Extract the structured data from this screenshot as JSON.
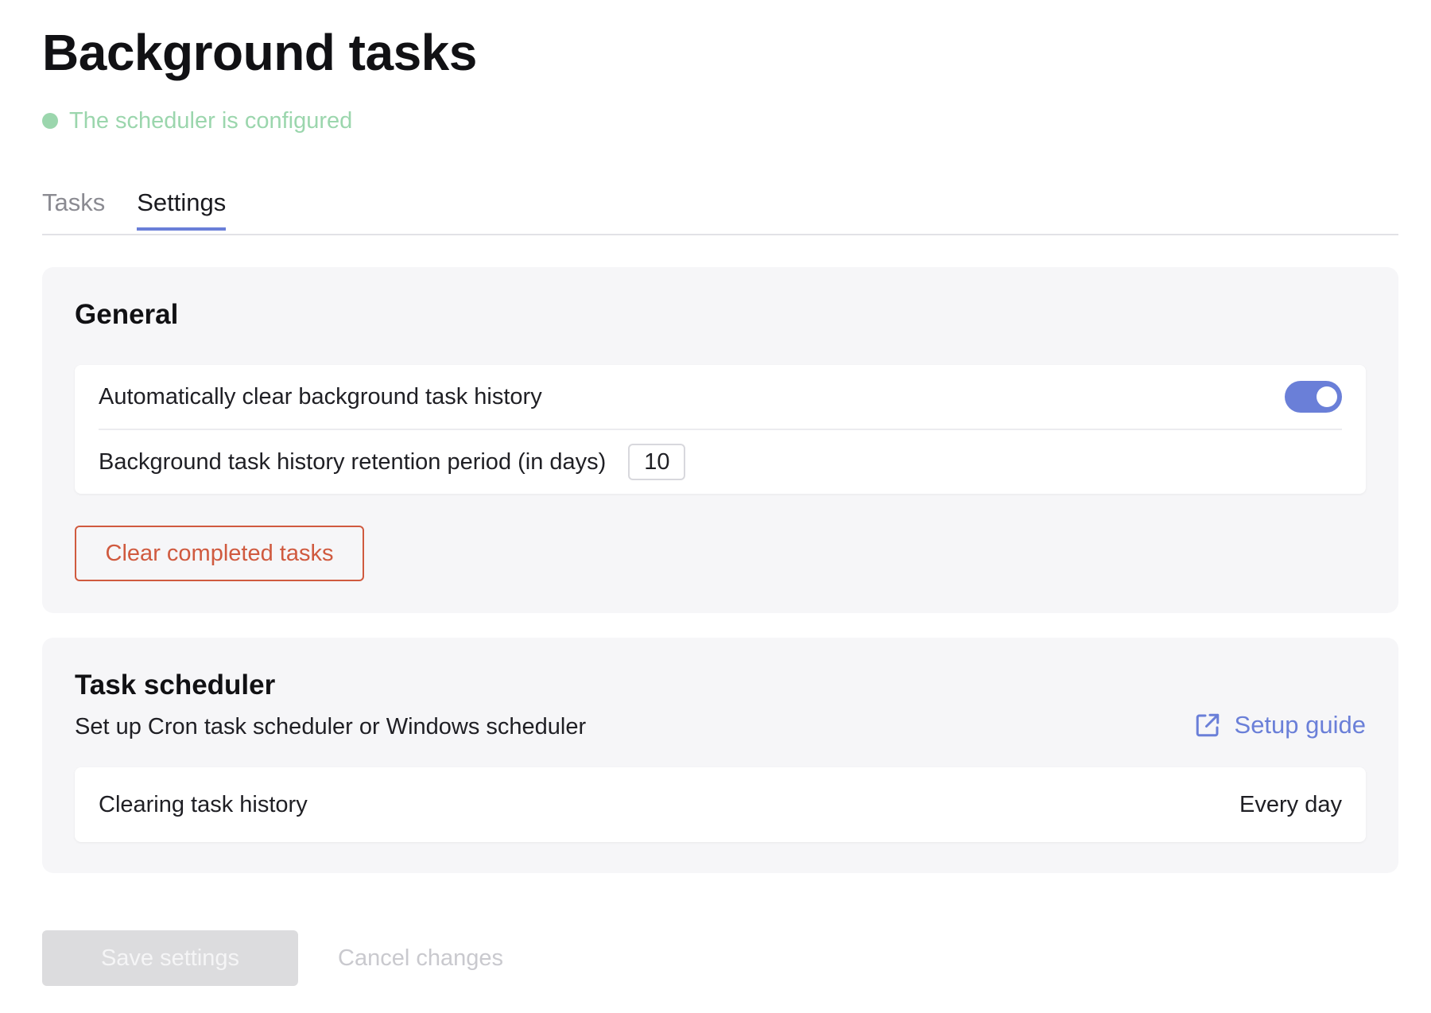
{
  "page": {
    "title": "Background tasks",
    "status_text": "The scheduler is configured",
    "status_color": "#9bd6ad"
  },
  "tabs": [
    {
      "label": "Tasks",
      "active": false
    },
    {
      "label": "Settings",
      "active": true
    }
  ],
  "general": {
    "heading": "General",
    "auto_clear_label": "Automatically clear background task history",
    "auto_clear_enabled": true,
    "retention_label": "Background task history retention period (in days)",
    "retention_value": "10",
    "clear_button_label": "Clear completed tasks"
  },
  "scheduler": {
    "heading": "Task scheduler",
    "subtitle": "Set up Cron task scheduler or Windows scheduler",
    "setup_guide_label": "Setup guide",
    "setup_guide_icon": "external-link-icon",
    "row_label": "Clearing task history",
    "row_value": "Every day"
  },
  "footer": {
    "save_label": "Save settings",
    "cancel_label": "Cancel changes"
  },
  "colors": {
    "accent": "#6a7fd8",
    "danger": "#d05a3f",
    "disabled_button": "#dcdcde"
  }
}
